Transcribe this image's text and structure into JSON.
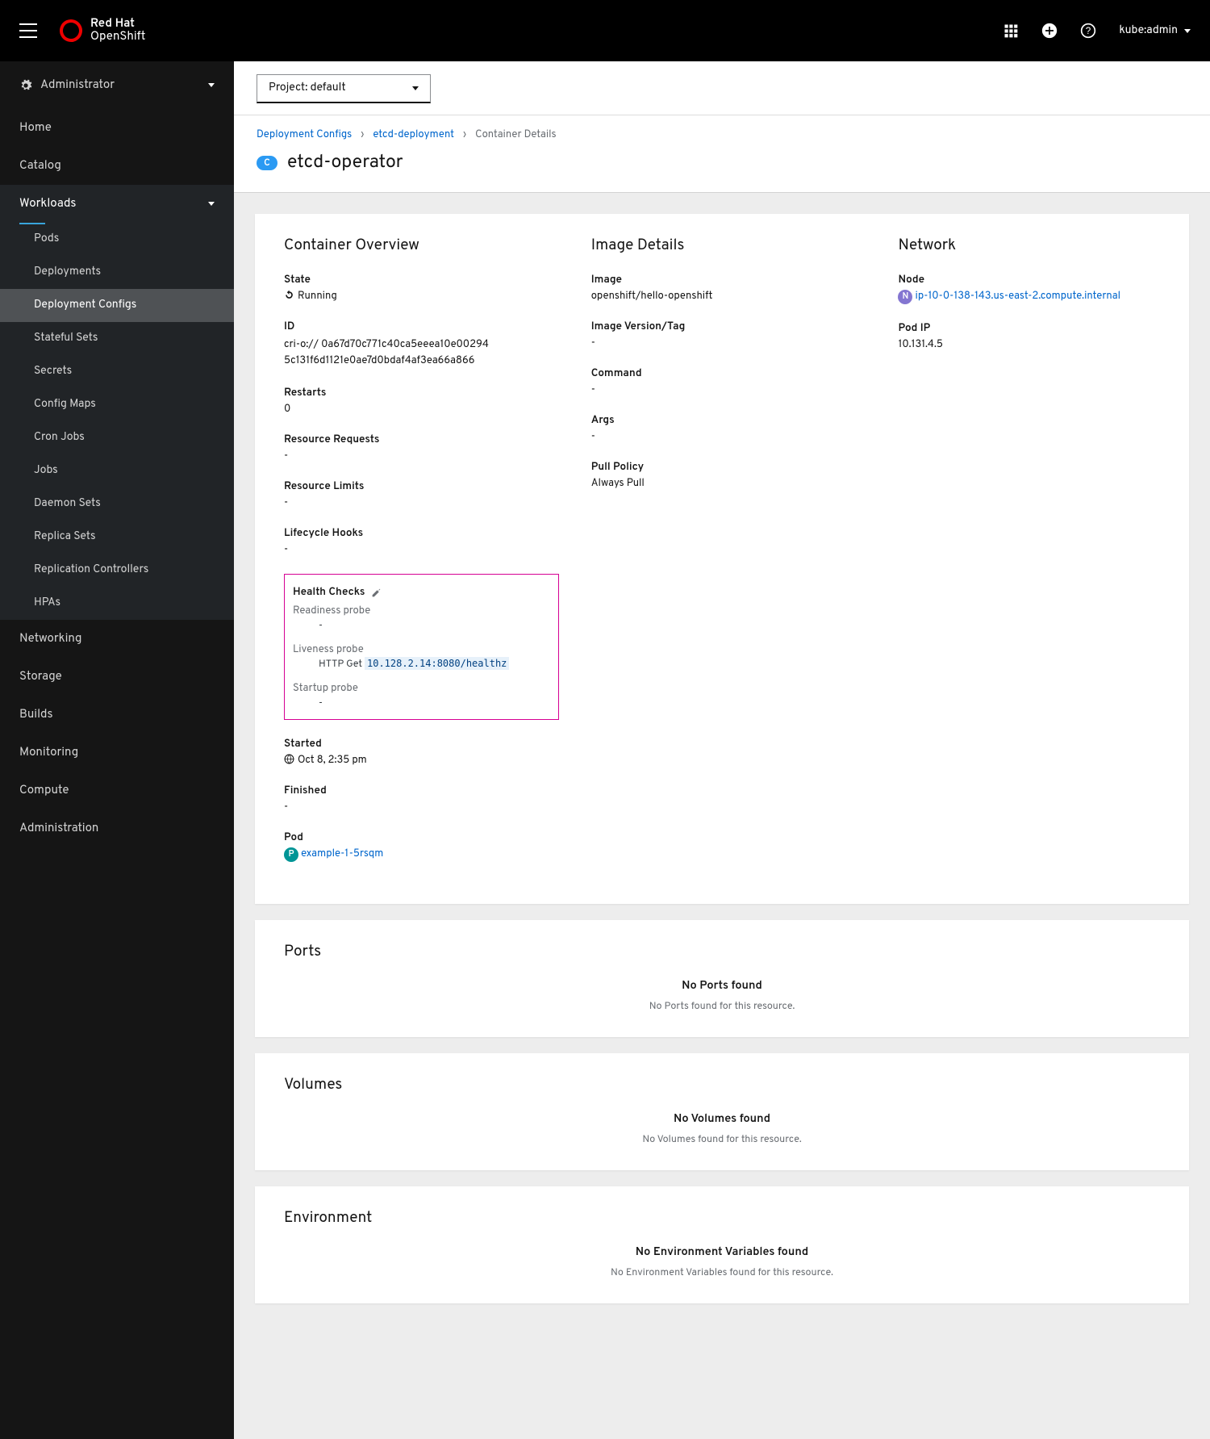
{
  "masthead": {
    "brand_line1": "Red Hat",
    "brand_line2": "OpenShift",
    "user": "kube:admin"
  },
  "sidebar": {
    "perspective": "Administrator",
    "sections": {
      "home": "Home",
      "catalog": "Catalog",
      "workloads": "Workloads",
      "networking": "Networking",
      "storage": "Storage",
      "builds": "Builds",
      "monitoring": "Monitoring",
      "compute": "Compute",
      "administration": "Administration"
    },
    "workloads_items": [
      "Pods",
      "Deployments",
      "Deployment Configs",
      "Stateful Sets",
      "Secrets",
      "Config Maps",
      "Cron Jobs",
      "Jobs",
      "Daemon Sets",
      "Replica Sets",
      "Replication Controllers",
      "HPAs"
    ]
  },
  "project_selector": "Project: default",
  "breadcrumbs": {
    "a": "Deployment Configs",
    "b": "etcd-deployment",
    "c": "Container Details"
  },
  "title": "etcd-operator",
  "overview": {
    "heading": "Container Overview",
    "state_label": "State",
    "state_value": "Running",
    "id_label": "ID",
    "id_value": "cri-o://\n0a67d70c771c40ca5eeea10e002945c131f6d1121e0ae7d0bdaf4af3ea66a866",
    "restarts_label": "Restarts",
    "restarts_value": "0",
    "rreq_label": "Resource Requests",
    "rlim_label": "Resource Limits",
    "lch_label": "Lifecycle Hooks",
    "hc_label": "Health Checks",
    "readiness_label": "Readiness probe",
    "liveness_label": "Liveness probe",
    "liveness_value_pfx": "HTTP Get ",
    "liveness_value_url": "10.128.2.14:8080/healthz",
    "startup_label": "Startup probe",
    "started_label": "Started",
    "started_value": "Oct 8, 2:35 pm",
    "finished_label": "Finished",
    "pod_label": "Pod",
    "pod_link": "example-1-5rsqm"
  },
  "image": {
    "heading": "Image Details",
    "image_label": "Image",
    "image_value": "openshift/hello-openshift",
    "ver_label": "Image Version/Tag",
    "cmd_label": "Command",
    "args_label": "Args",
    "pull_label": "Pull Policy",
    "pull_value": "Always Pull"
  },
  "network": {
    "heading": "Network",
    "node_label": "Node",
    "node_link": "ip-10-0-138-143.us-east-2.compute.internal",
    "podip_label": "Pod IP",
    "podip_value": "10.131.4.5"
  },
  "ports": {
    "heading": "Ports",
    "empty_title": "No Ports found",
    "empty_sub": "No Ports found for this resource."
  },
  "volumes": {
    "heading": "Volumes",
    "empty_title": "No Volumes found",
    "empty_sub": "No Volumes found for this resource."
  },
  "env": {
    "heading": "Environment",
    "empty_title": "No Environment Variables found",
    "empty_sub": "No Environment Variables found for this resource."
  }
}
